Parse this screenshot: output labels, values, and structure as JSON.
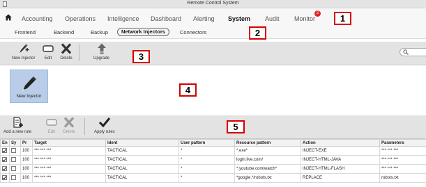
{
  "window": {
    "title": "Remote Control System"
  },
  "main_tabs": [
    {
      "label": "Accounting",
      "active": false
    },
    {
      "label": "Operations",
      "active": false
    },
    {
      "label": "Intelligence",
      "active": false
    },
    {
      "label": "Dashboard",
      "active": false
    },
    {
      "label": "Alerting",
      "active": false
    },
    {
      "label": "System",
      "active": true
    },
    {
      "label": "Audit",
      "active": false
    },
    {
      "label": "Monitor",
      "active": false
    }
  ],
  "monitor_badge": "2",
  "sub_tabs": [
    {
      "label": "Frontend",
      "active": false
    },
    {
      "label": "Backend",
      "active": false
    },
    {
      "label": "Backup",
      "active": false
    },
    {
      "label": "Network Injectors",
      "active": true
    },
    {
      "label": "Connectors",
      "active": false
    }
  ],
  "injector_toolbar": {
    "new_label": "New Injector",
    "edit_label": "Edit",
    "delete_label": "Delete",
    "upgrade_label": "Upgrade"
  },
  "injector_tile": {
    "label": "New Injector"
  },
  "rules_toolbar": {
    "add_label": "Add a new rule",
    "edit_label": "Edit",
    "delete_label": "Delete",
    "apply_label": "Apply rules"
  },
  "rules_table": {
    "columns": [
      "En",
      "Sy",
      "Pr",
      "Target",
      "Ident",
      "User pattern",
      "Resource pattern",
      "Action",
      "Parameters"
    ],
    "rows": [
      {
        "en": true,
        "sy": false,
        "pr": "100",
        "target": "*** *** ***",
        "ident": "TACTICAL",
        "user_pattern": "*",
        "resource_pattern": "*.exe*",
        "action": "INJECT-EXE",
        "parameters": "*** *** ***"
      },
      {
        "en": true,
        "sy": false,
        "pr": "100",
        "target": "*** *** ***",
        "ident": "TACTICAL",
        "user_pattern": "*",
        "resource_pattern": "login.live.com/",
        "action": "INJECT-HTML-JAVA",
        "parameters": "*** *** ***"
      },
      {
        "en": true,
        "sy": false,
        "pr": "100",
        "target": "*** *** ***",
        "ident": "TACTICAL",
        "user_pattern": "*",
        "resource_pattern": "*.youtube.com/watch*",
        "action": "INJECT-HTML-FLASH",
        "parameters": "*** *** ***"
      },
      {
        "en": true,
        "sy": false,
        "pr": "100",
        "target": "*** *** ***",
        "ident": "TACTICAL",
        "user_pattern": "*",
        "resource_pattern": "*google.*/robots.txt",
        "action": "REPLACE",
        "parameters": "robots.txt"
      }
    ]
  },
  "annotations": [
    "1",
    "2",
    "3",
    "4",
    "5"
  ],
  "colors": {
    "tile_bg": "#b9cde8",
    "badge": "#d9262c",
    "annotation_border": "#d40000",
    "toolbar_bg": "#e3e3e3"
  }
}
